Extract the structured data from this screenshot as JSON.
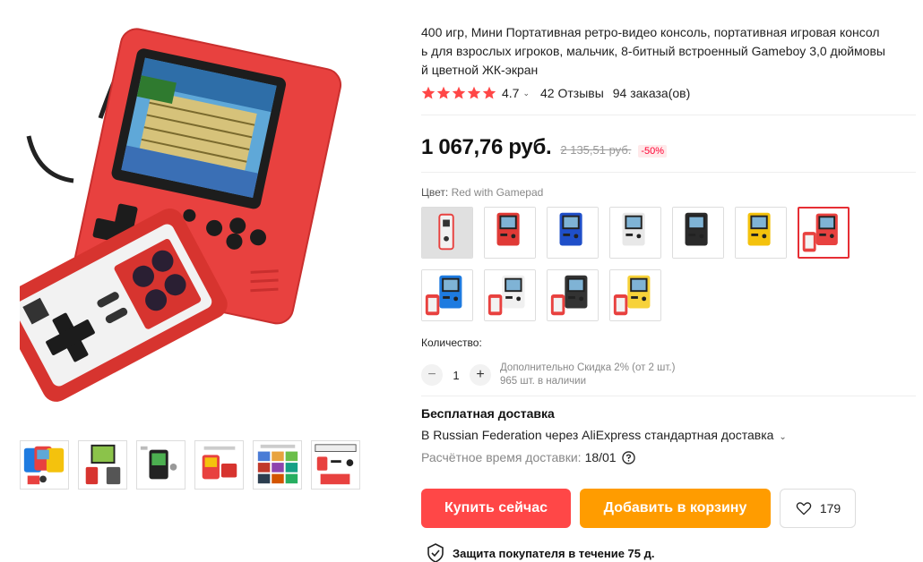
{
  "product": {
    "title": "400 игр, Мини Портативная ретро-видео консоль, портативная игровая консоль для взрослых игроков, мальчик, 8-битный встроенный Gameboy 3,0 дюймовый цветной ЖК-экран",
    "title_line1": "400 игр, Мини Портативная ретро-видео консоль, портативная игровая консол",
    "title_line2": "ь для взрослых игроков, мальчик, 8-битный встроенный Gameboy 3,0 дюймовы",
    "title_line3": "й цветной ЖК-экран"
  },
  "rating": {
    "value": "4.7",
    "stars": 5,
    "reviews": "42 Отзывы",
    "orders": "94 заказа(ов)"
  },
  "price": {
    "current": "1 067,76 руб.",
    "old": "2 135,51 руб.",
    "discount": "-50%"
  },
  "color": {
    "label": "Цвет:",
    "selected_value": "Red with Gamepad",
    "options": [
      {
        "name": "Red with Gamepad (gamepad only)",
        "color": "#e8413f",
        "selected": false
      },
      {
        "name": "Red",
        "color": "#e03a36",
        "selected": false
      },
      {
        "name": "Blue",
        "color": "#1f4fc9",
        "selected": false
      },
      {
        "name": "White",
        "color": "#e8e8e8",
        "selected": false
      },
      {
        "name": "Black",
        "color": "#2a2a2a",
        "selected": false
      },
      {
        "name": "Yellow",
        "color": "#f4c20d",
        "selected": false
      },
      {
        "name": "Red with Gamepad",
        "color": "#e8413f",
        "selected": true
      },
      {
        "name": "Blue with Gamepad",
        "color": "#1e7be0",
        "selected": false
      },
      {
        "name": "White with Gamepad",
        "color": "#f0f0f0",
        "selected": false
      },
      {
        "name": "Black with Gamepad",
        "color": "#333333",
        "selected": false
      },
      {
        "name": "Yellow with Gamepad",
        "color": "#f7d23a",
        "selected": false
      }
    ]
  },
  "quantity": {
    "label": "Количество:",
    "value": "1",
    "minus": "−",
    "plus": "+",
    "note_discount": "Дополнительно Скидка 2% (от 2 шт.)",
    "note_stock": "965 шт. в наличии"
  },
  "shipping": {
    "title": "Бесплатная доставка",
    "line": "В Russian Federation через AliExpress стандартная доставка",
    "time_label": "Расчётное время доставки:",
    "time_value": "18/01"
  },
  "actions": {
    "buy": "Купить сейчас",
    "cart": "Добавить в корзину",
    "wishlist_count": "179"
  },
  "protection": {
    "text": "Защита покупателя в течение 75 д."
  },
  "gallery": {
    "thumb_labels": [
      "400 Games",
      "PRODUCT LIST"
    ]
  },
  "colors": {
    "accent_red": "#ff4747",
    "accent_orange": "#ff9c00",
    "star": "#ff4747",
    "console_red": "#e8413f"
  }
}
